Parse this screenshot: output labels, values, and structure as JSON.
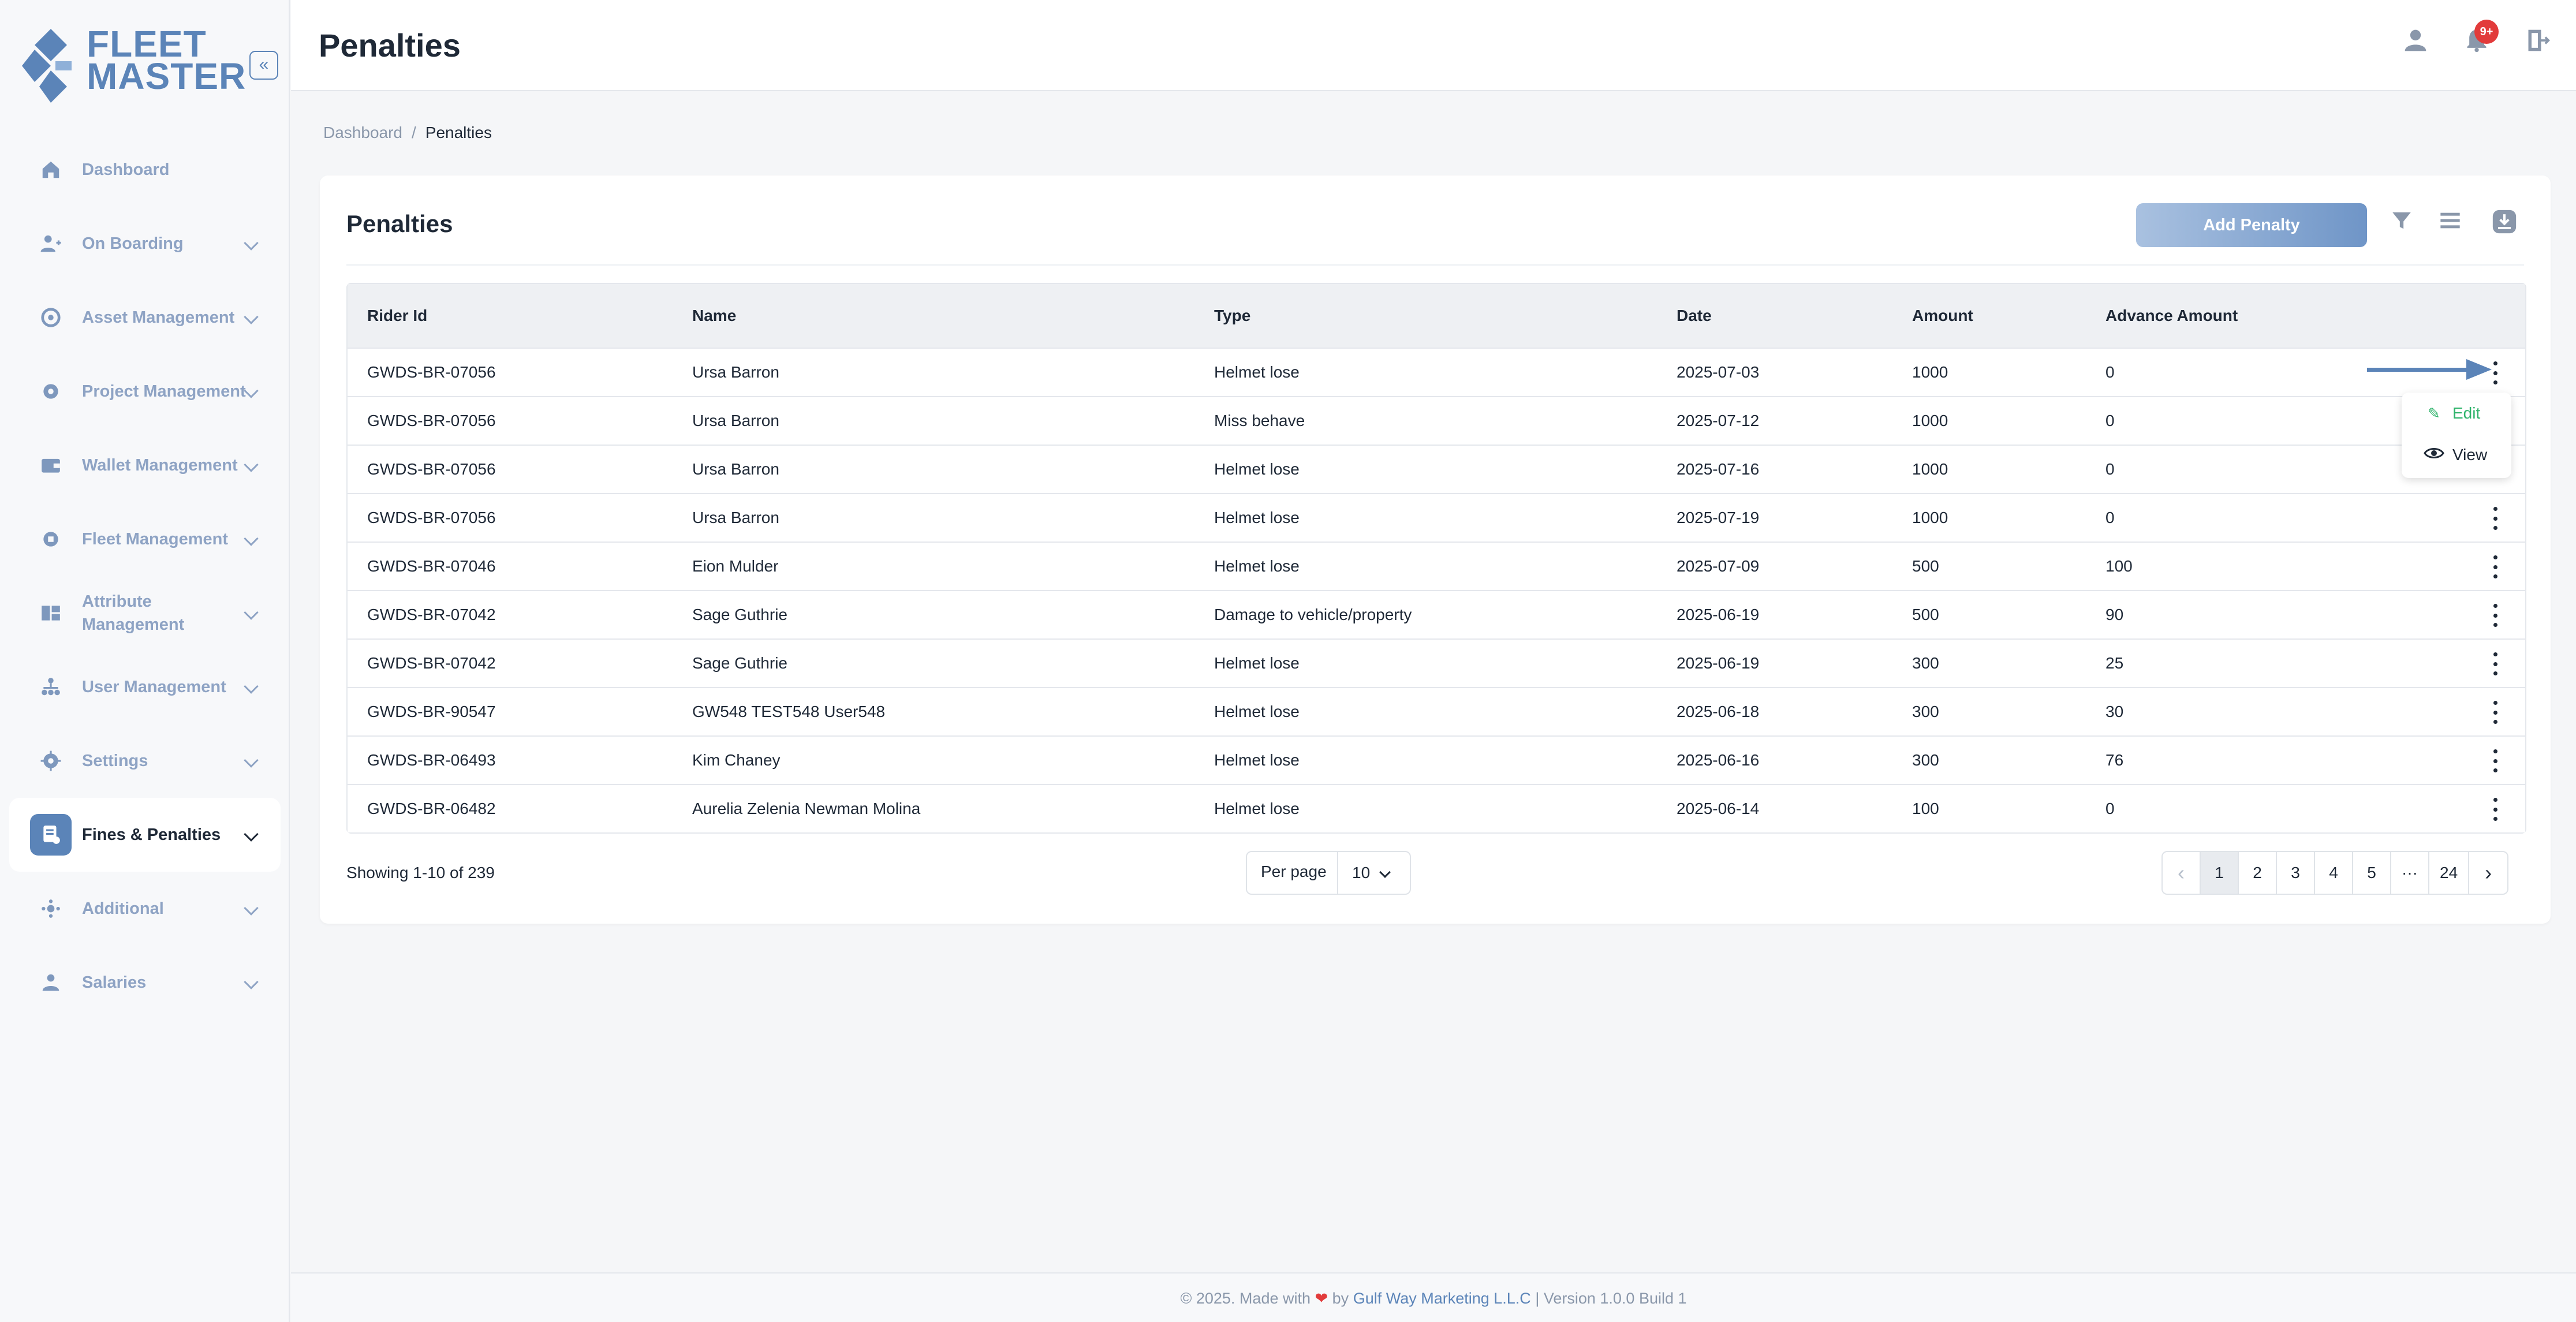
{
  "brand": {
    "line1": "FLEET",
    "line2": "MASTER",
    "accent": "#5b84b8"
  },
  "header": {
    "title": "Penalties",
    "notification_badge": "9+"
  },
  "sidebar": {
    "items": [
      {
        "label": "Dashboard",
        "icon": "home-icon",
        "has_chevron": false
      },
      {
        "label": "On Boarding",
        "icon": "person-add-icon",
        "has_chevron": true
      },
      {
        "label": "Asset Management",
        "icon": "asset-icon",
        "has_chevron": true
      },
      {
        "label": "Project Management",
        "icon": "project-icon",
        "has_chevron": true
      },
      {
        "label": "Wallet Management",
        "icon": "wallet-icon",
        "has_chevron": true
      },
      {
        "label": "Fleet Management",
        "icon": "fleet-icon",
        "has_chevron": true
      },
      {
        "label": "Attribute Management",
        "icon": "attribute-icon",
        "has_chevron": true
      },
      {
        "label": "User Management",
        "icon": "users-icon",
        "has_chevron": true
      },
      {
        "label": "Settings",
        "icon": "gear-icon",
        "has_chevron": true
      },
      {
        "label": "Fines & Penalties",
        "icon": "fines-icon",
        "has_chevron": true,
        "active": true
      },
      {
        "label": "Additional",
        "icon": "additional-icon",
        "has_chevron": true
      },
      {
        "label": "Salaries",
        "icon": "salaries-icon",
        "has_chevron": true
      }
    ]
  },
  "breadcrumb": {
    "root": "Dashboard",
    "separator": "/",
    "current": "Penalties"
  },
  "card": {
    "title": "Penalties",
    "add_button": "Add Penalty"
  },
  "table": {
    "columns": [
      "Rider Id",
      "Name",
      "Type",
      "Date",
      "Amount",
      "Advance Amount"
    ],
    "rows": [
      [
        "GWDS-BR-07056",
        "Ursa Barron",
        "Helmet lose",
        "2025-07-03",
        "1000",
        "0"
      ],
      [
        "GWDS-BR-07056",
        "Ursa Barron",
        "Miss behave",
        "2025-07-12",
        "1000",
        "0"
      ],
      [
        "GWDS-BR-07056",
        "Ursa Barron",
        "Helmet lose",
        "2025-07-16",
        "1000",
        "0"
      ],
      [
        "GWDS-BR-07056",
        "Ursa Barron",
        "Helmet lose",
        "2025-07-19",
        "1000",
        "0"
      ],
      [
        "GWDS-BR-07046",
        "Eion Mulder",
        "Helmet lose",
        "2025-07-09",
        "500",
        "100"
      ],
      [
        "GWDS-BR-07042",
        "Sage Guthrie",
        "Damage to vehicle/property",
        "2025-06-19",
        "500",
        "90"
      ],
      [
        "GWDS-BR-07042",
        "Sage Guthrie",
        "Helmet lose",
        "2025-06-19",
        "300",
        "25"
      ],
      [
        "GWDS-BR-90547",
        "GW548 TEST548 User548",
        "Helmet lose",
        "2025-06-18",
        "300",
        "30"
      ],
      [
        "GWDS-BR-06493",
        "Kim Chaney",
        "Helmet lose",
        "2025-06-16",
        "300",
        "76"
      ],
      [
        "GWDS-BR-06482",
        "Aurelia Zelenia Newman Molina",
        "Helmet lose",
        "2025-06-14",
        "100",
        "0"
      ]
    ]
  },
  "row_menu": {
    "edit": "Edit",
    "view": "View"
  },
  "pagination": {
    "showing": "Showing 1-10 of 239",
    "per_page_label": "Per page",
    "per_page_value": "10",
    "pages": [
      "1",
      "2",
      "3",
      "4",
      "5",
      "···",
      "24"
    ],
    "current": "1"
  },
  "footer": {
    "prefix": "© 2025. Made with",
    "by": "by",
    "company": "Gulf Way Marketing L.L.C",
    "suffix": "| Version 1.0.0 Build 1"
  }
}
